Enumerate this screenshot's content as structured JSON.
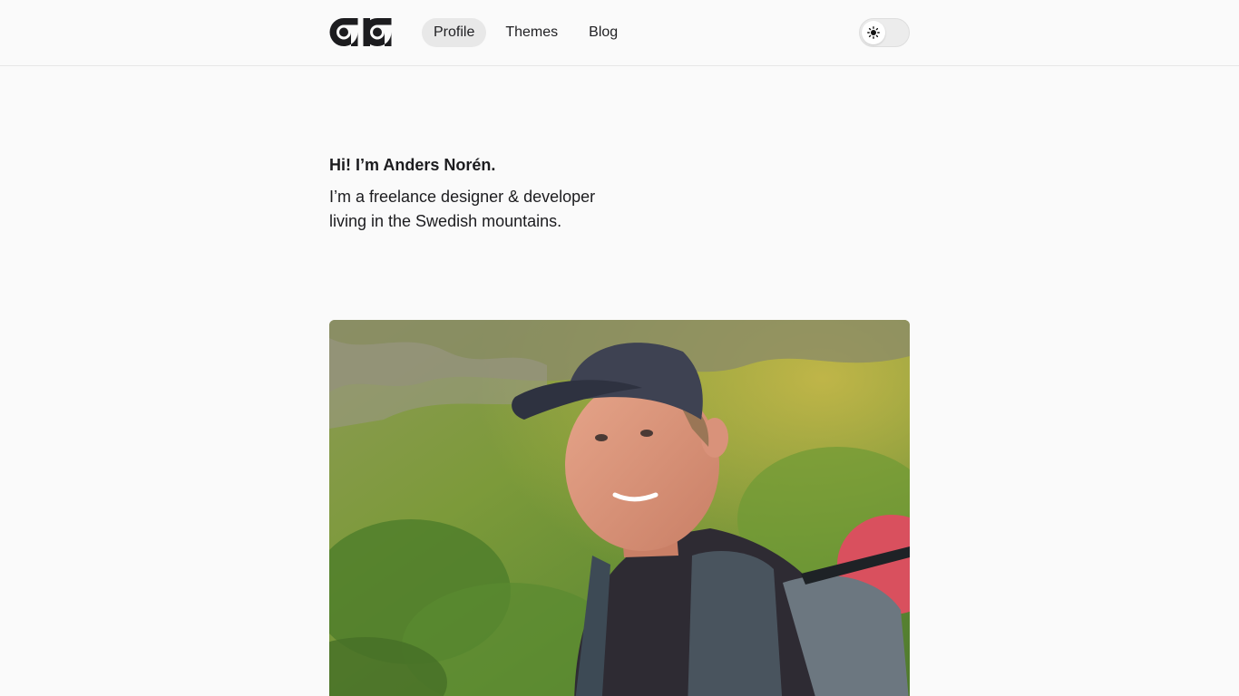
{
  "header": {
    "logo_alt": "Anders Norén logo",
    "nav": [
      {
        "label": "Profile",
        "active": true
      },
      {
        "label": "Themes",
        "active": false
      },
      {
        "label": "Blog",
        "active": false
      }
    ],
    "theme_toggle": {
      "state": "light",
      "icon": "sun-icon"
    }
  },
  "intro": {
    "title": "Hi! I’m Anders Norén.",
    "text": "I’m a freelance designer & developer living in the Swedish mountains."
  },
  "photo": {
    "alt": "Portrait of a man in a cap with a backpack on a green mountain slope"
  },
  "colors": {
    "background": "#fafafa",
    "text": "#1c1c1f",
    "nav_active_bg": "#e8e8e8",
    "logo": "#1c1c1f"
  }
}
